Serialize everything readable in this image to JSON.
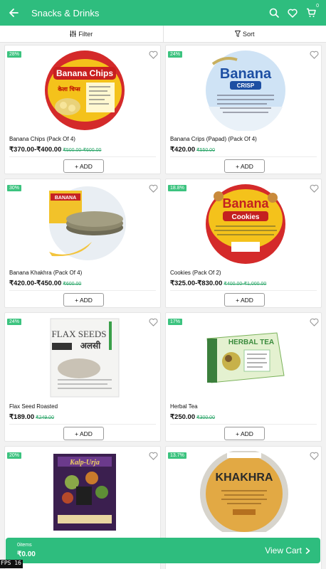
{
  "header": {
    "title": "Snacks & Drinks",
    "cart_count": "0",
    "back_icon": "back-arrow-icon",
    "search_icon": "search-icon",
    "wishlist_icon": "heart-icon",
    "cart_icon": "cart-icon"
  },
  "toolbar": {
    "filter_label": "Filter",
    "sort_label": "Sort"
  },
  "products": [
    {
      "badge": "28%",
      "name": "Banana Chips (Pack Of 4)",
      "price": "₹370.00-₹400.00",
      "mrp": "₹500.00-₹600.00",
      "add_label": "+ ADD",
      "image_text": "Banana Chips",
      "image_sub": "केला चिप्स"
    },
    {
      "badge": "24%",
      "name": "Banana Crips (Papad) (Pack Of 4)",
      "price": "₹420.00",
      "mrp": "₹550.00",
      "add_label": "+ ADD",
      "image_text": "Banana",
      "image_sub": "CRISP"
    },
    {
      "badge": "30%",
      "name": "Banana Khakhra (Pack Of 4)",
      "price": "₹420.00-₹450.00",
      "mrp": "₹600.00",
      "add_label": "+ ADD",
      "image_text": "BANANA"
    },
    {
      "badge": "18.8%",
      "name": "Cookies (Pack Of 2)",
      "price": "₹325.00-₹830.00",
      "mrp": "₹400.00-₹1,000.00",
      "add_label": "+ ADD",
      "image_text": "Banana",
      "image_sub": "Cookies"
    },
    {
      "badge": "24%",
      "name": "Flax Seed Roasted",
      "price": "₹189.00",
      "mrp": "₹249.00",
      "add_label": "+ ADD",
      "image_text": "FLAX SEEDS",
      "image_sub": "अलसी"
    },
    {
      "badge": "17%",
      "name": "Herbal Tea",
      "price": "₹250.00",
      "mrp": "₹300.00",
      "add_label": "+ ADD",
      "image_text": "HERBAL TEA"
    },
    {
      "badge": "20%",
      "image_text": "Kalp-Urja"
    },
    {
      "badge": "13.7%",
      "image_text": "KHAKHRA"
    }
  ],
  "cart": {
    "items_label": "0items",
    "total": "₹0.00",
    "view_label": "View Cart"
  },
  "fps_label": "FPS 16",
  "colors": {
    "primary": "#2ebd7e",
    "badge": "#3cc37f",
    "strike_price": "#2ea76b"
  }
}
